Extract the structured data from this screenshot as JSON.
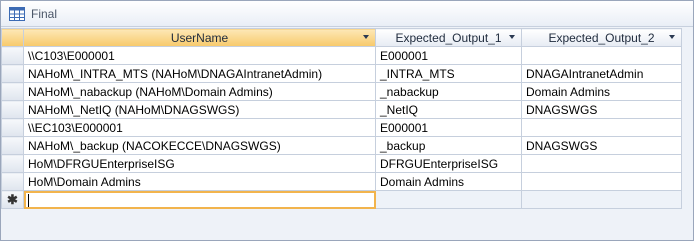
{
  "window": {
    "title": "Final"
  },
  "grid": {
    "columns": [
      {
        "key": "username",
        "label": "UserName"
      },
      {
        "key": "out1",
        "label": "Expected_Output_1"
      },
      {
        "key": "out2",
        "label": "Expected_Output_2"
      }
    ],
    "rows": [
      {
        "username": "\\\\C103\\E000001",
        "out1": "E000001",
        "out2": ""
      },
      {
        "username": "NAHoM\\_INTRA_MTS (NAHoM\\DNAGAIntranetAdmin)",
        "out1": "_INTRA_MTS",
        "out2": "DNAGAIntranetAdmin"
      },
      {
        "username": "NAHoM\\_nabackup (NAHoM\\Domain Admins)",
        "out1": "_nabackup",
        "out2": "Domain Admins"
      },
      {
        "username": "NAHoM\\_NetIQ (NAHoM\\DNAGSWGS)",
        "out1": "_NetIQ",
        "out2": "DNAGSWGS"
      },
      {
        "username": "\\\\EC103\\E000001",
        "out1": "E000001",
        "out2": ""
      },
      {
        "username": "NAHoM\\_backup (NACOKECCE\\DNAGSWGS)",
        "out1": "_backup",
        "out2": "DNAGSWGS"
      },
      {
        "username": "HoM\\DFRGUEnterpriseISG",
        "out1": "DFRGUEnterpriseISG",
        "out2": ""
      },
      {
        "username": "HoM\\Domain Admins",
        "out1": "Domain Admins",
        "out2": ""
      }
    ],
    "new_row_marker": "✱"
  },
  "colors": {
    "sorted_header": "#f7c96a",
    "active_cell_border": "#f2b44d",
    "grid_line": "#c6cfdd"
  }
}
